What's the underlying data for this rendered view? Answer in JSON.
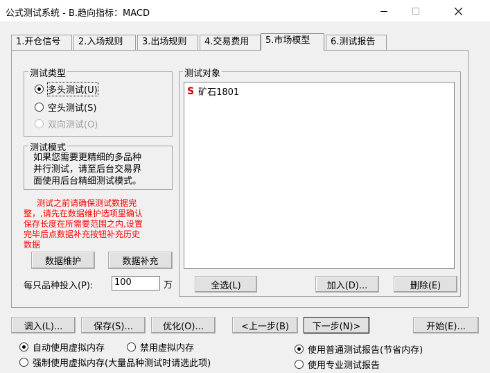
{
  "window": {
    "title": "公式测试系统 - B.趋向指标：MACD"
  },
  "tabs": [
    {
      "label": "1.开仓信号"
    },
    {
      "label": "2.入场规则"
    },
    {
      "label": "3.出场规则"
    },
    {
      "label": "4.交易费用"
    },
    {
      "label": "5.市场模型"
    },
    {
      "label": "6.测试报告"
    }
  ],
  "test_type": {
    "title": "测试类型",
    "options": [
      {
        "label": "多头测试(U)",
        "checked": true
      },
      {
        "label": "空头测试(S)",
        "checked": false
      },
      {
        "label": "双向测试(O)",
        "checked": false,
        "disabled": true
      }
    ]
  },
  "test_mode": {
    "title": "测试模式",
    "text_lines": [
      "如果您需要更精细的多品种",
      "并行测试，请至后台交易界",
      "面使用后台精细测试模式。"
    ]
  },
  "warning_lines": [
    "     测试之前请确保测试数据完",
    "整，,请先在数据维护选项里确认",
    "保存长度在所需要范围之内,设置",
    "完毕后点数据补充按钮补充历史",
    "数据"
  ],
  "buttons": {
    "data_maintain": "数据维护",
    "data_supplement": "数据补充",
    "select_all": "全选(L)",
    "add": "加入(D)...",
    "remove": "删除(E)",
    "load": "调入(L)...",
    "save": "保存(S)...",
    "optimize": "优化(O)...",
    "prev": "<上一步(B)",
    "next": "下一步(N)>",
    "start": "开始(E)..."
  },
  "investment": {
    "label": "每只品种投入(P):",
    "value": "100",
    "unit": "万"
  },
  "test_objects": {
    "title": "测试对象",
    "items": [
      {
        "badge": "S",
        "name": "矿石1801"
      }
    ]
  },
  "memory_options": [
    {
      "label": "自动使用虚拟内存",
      "checked": true
    },
    {
      "label": "禁用虚拟内存",
      "checked": false
    },
    {
      "label": "强制使用虚拟内存(大量品种测试时请选此项)",
      "checked": false
    }
  ],
  "report_options": [
    {
      "label": "使用普通测试报告(节省内存)",
      "checked": true
    },
    {
      "label": "使用专业测试报告",
      "checked": false
    }
  ],
  "colors": {
    "warning": "#ff0000",
    "badge": "#d00000",
    "background": "#f0f0f0"
  }
}
